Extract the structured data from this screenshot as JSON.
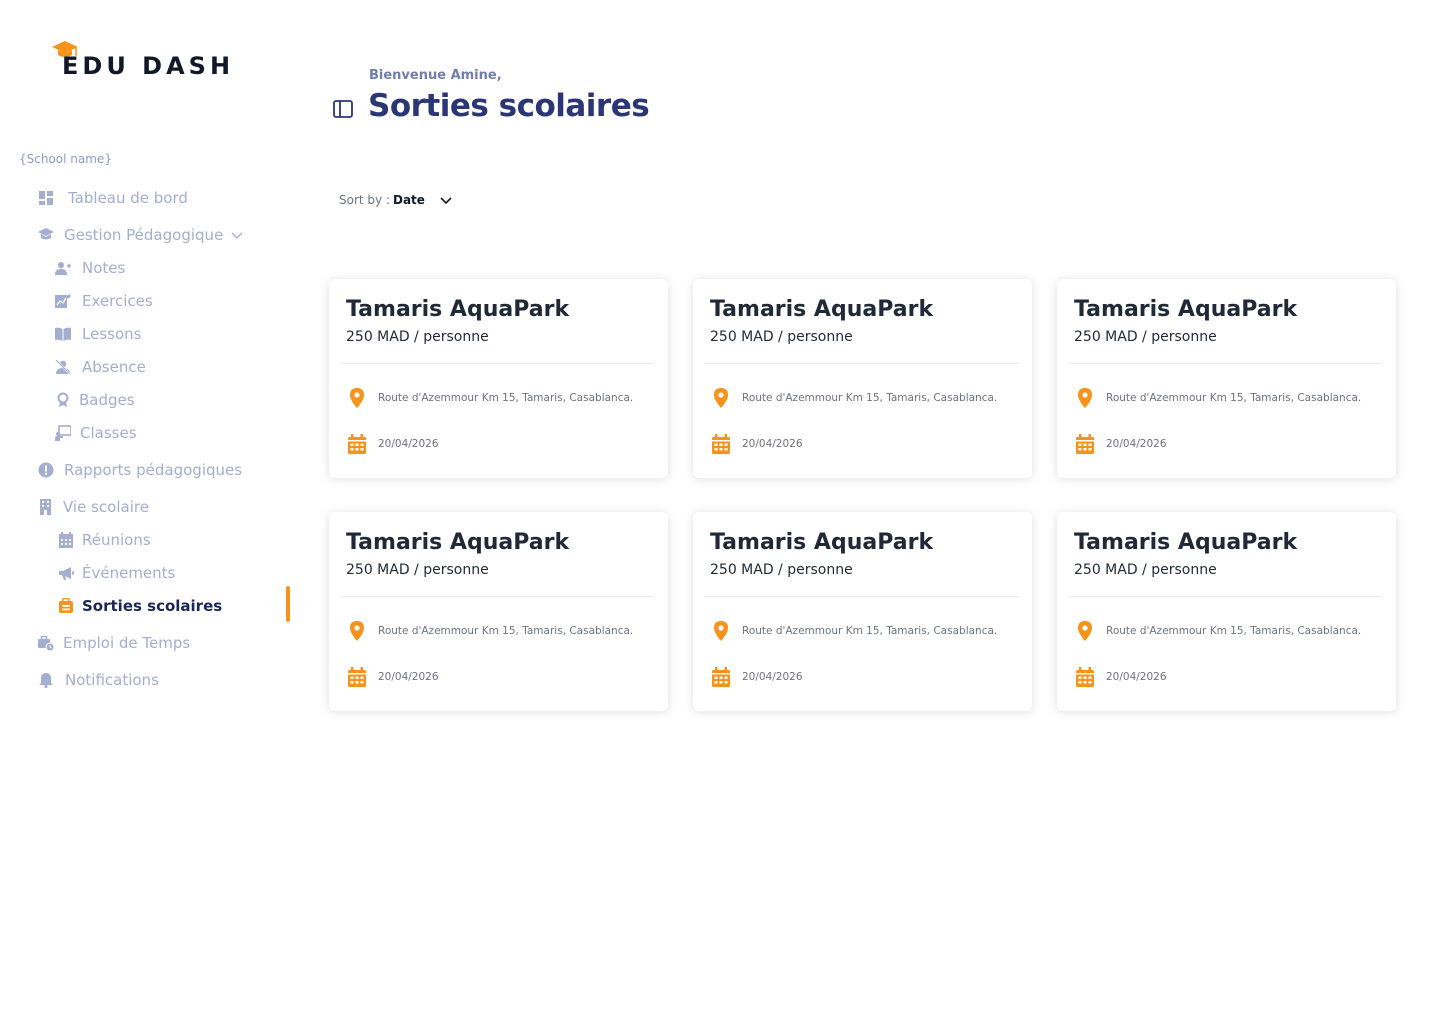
{
  "app": {
    "logo_text": "EDU DASH",
    "school_name": "{School name}"
  },
  "colors": {
    "accent": "#f7931a",
    "title": "#2b3674",
    "muted": "#a3aed0"
  },
  "sidebar": {
    "items": [
      {
        "label": "Tableau de bord",
        "icon": "dashboard-icon"
      },
      {
        "label": "Gestion Pédagogique",
        "icon": "graduation-icon"
      },
      {
        "label": "Notes",
        "icon": "user-add-icon"
      },
      {
        "label": "Exercices",
        "icon": "edit-chart-icon"
      },
      {
        "label": "Lessons",
        "icon": "book-icon"
      },
      {
        "label": "Absence",
        "icon": "user-off-icon"
      },
      {
        "label": "Badges",
        "icon": "badge-icon"
      },
      {
        "label": "Classes",
        "icon": "classroom-icon"
      },
      {
        "label": "Rapports pédagogiques",
        "icon": "alert-icon"
      },
      {
        "label": "Vie scolaire",
        "icon": "building-icon"
      },
      {
        "label": "Réunions",
        "icon": "calendar-icon"
      },
      {
        "label": "Événements",
        "icon": "megaphone-icon"
      },
      {
        "label": "Sorties scolaires",
        "icon": "trip-icon"
      },
      {
        "label": "Emploi de Temps",
        "icon": "briefcase-clock-icon"
      },
      {
        "label": "Notifications",
        "icon": "bell-icon"
      }
    ]
  },
  "header": {
    "welcome": "Bienvenue Amine,",
    "title": "Sorties scolaires"
  },
  "sort": {
    "label": "Sort by :",
    "value": "Date"
  },
  "cards": [
    {
      "title": "Tamaris AquaPark",
      "price": "250 MAD / personne",
      "location": "Route d'Azemmour Km 15, Tamaris, Casablanca.",
      "date": "20/04/2026"
    },
    {
      "title": "Tamaris AquaPark",
      "price": "250 MAD / personne",
      "location": "Route d'Azemmour Km 15, Tamaris, Casablanca.",
      "date": "20/04/2026"
    },
    {
      "title": "Tamaris AquaPark",
      "price": "250 MAD / personne",
      "location": "Route d'Azemmour Km 15, Tamaris, Casablanca.",
      "date": "20/04/2026"
    },
    {
      "title": "Tamaris AquaPark",
      "price": "250 MAD / personne",
      "location": "Route d'Azemmour Km 15, Tamaris, Casablanca.",
      "date": "20/04/2026"
    },
    {
      "title": "Tamaris AquaPark",
      "price": "250 MAD / personne",
      "location": "Route d'Azemmour Km 15, Tamaris, Casablanca.",
      "date": "20/04/2026"
    },
    {
      "title": "Tamaris AquaPark",
      "price": "250 MAD / personne",
      "location": "Route d'Azemmour Km 15, Tamaris, Casablanca.",
      "date": "20/04/2026"
    }
  ]
}
